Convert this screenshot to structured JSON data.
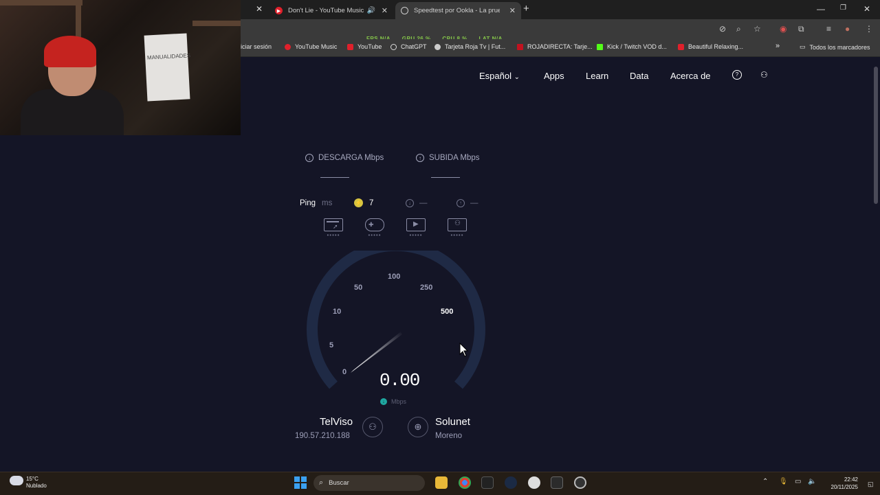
{
  "browser": {
    "tabs": [
      {
        "title": "Don't Lie - YouTube Music",
        "active": false
      },
      {
        "title": "Speedtest por Ookla - La prueb",
        "active": true
      }
    ],
    "overlay": {
      "fps": "FPS N/A",
      "gpu": "GPU 26 %",
      "cpu": "CPU 8 %",
      "lat": "LAT N/A"
    },
    "bookmarks": [
      {
        "label": "iciar sesión",
        "icon": "login-icon"
      },
      {
        "label": "YouTube Music",
        "icon": "youtube-music-icon"
      },
      {
        "label": "YouTube",
        "icon": "youtube-icon"
      },
      {
        "label": "ChatGPT",
        "icon": "chatgpt-icon"
      },
      {
        "label": "Tarjeta Roja Tv | Fut...",
        "icon": "tarjeta-roja-icon"
      },
      {
        "label": "ROJADIRECTA: Tarje...",
        "icon": "rojadirecta-icon"
      },
      {
        "label": "Kick / Twitch VOD d...",
        "icon": "kick-icon"
      },
      {
        "label": "Beautiful Relaxing...",
        "icon": "youtube-icon"
      }
    ],
    "bookmarks_more": "»",
    "all_bookmarks": "Todos los marcadores"
  },
  "nav": {
    "language": "Español",
    "apps": "Apps",
    "learn": "Learn",
    "data": "Data",
    "about": "Acerca de"
  },
  "speedtest": {
    "download_label": "DESCARGA Mbps",
    "upload_label": "SUBIDA Mbps",
    "ping_label": "Ping",
    "ping_unit": "ms",
    "ping_value": "7",
    "download_ping": "—",
    "upload_ping": "—",
    "gauge_ticks": [
      "0",
      "5",
      "10",
      "50",
      "100",
      "250",
      "500"
    ],
    "speed_value": "0.00",
    "speed_unit": "Mbps",
    "isp_name": "TelViso",
    "isp_ip": "190.57.210.188",
    "server_name": "Solunet",
    "server_location": "Moreno"
  },
  "webcam": {
    "board_text": "MANUALIDADES"
  },
  "taskbar": {
    "weather_temp": "15°C",
    "weather_desc": "Nublado",
    "search_placeholder": "Buscar",
    "time": "22:42",
    "date": "20/11/2025"
  },
  "colors": {
    "page_bg": "#141526",
    "accent_teal": "#1fa7a0",
    "ping_yellow": "#d8c440"
  }
}
